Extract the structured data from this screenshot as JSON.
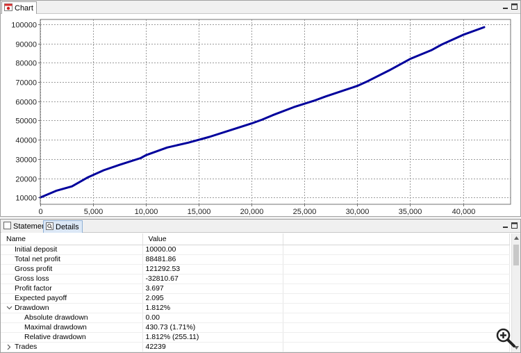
{
  "chart_tab": {
    "label": "Chart"
  },
  "details_tabs": {
    "statement": "Statement",
    "details": "Details"
  },
  "chart_data": {
    "type": "line",
    "x": [
      0,
      1500,
      3000,
      4500,
      6000,
      7500,
      9500,
      10000,
      12000,
      14000,
      16000,
      18000,
      20000,
      21000,
      22000,
      24000,
      26000,
      27000,
      30000,
      31000,
      33000,
      35000,
      37000,
      38000,
      40000,
      42000
    ],
    "y": [
      10000,
      13500,
      15800,
      20500,
      24200,
      27000,
      30500,
      32000,
      36000,
      38500,
      41500,
      45000,
      48500,
      50500,
      52800,
      57000,
      60500,
      62500,
      68000,
      70500,
      76000,
      82000,
      86500,
      89500,
      94500,
      98500
    ],
    "xlim": [
      0,
      44500
    ],
    "ylim": [
      6500,
      102500
    ],
    "xticks": [
      0,
      5000,
      10000,
      15000,
      20000,
      25000,
      30000,
      35000,
      40000
    ],
    "xtick_labels": [
      "0",
      "5,000",
      "10,000",
      "15,000",
      "20,000",
      "25,000",
      "30,000",
      "35,000",
      "40,000"
    ],
    "yticks": [
      10000,
      20000,
      30000,
      40000,
      50000,
      60000,
      70000,
      80000,
      90000,
      100000
    ],
    "ytick_labels": [
      "10000",
      "20000",
      "30000",
      "40000",
      "50000",
      "60000",
      "70000",
      "80000",
      "90000",
      "100000"
    ],
    "grid": true,
    "line_color": "#00009c"
  },
  "table": {
    "headers": {
      "name": "Name",
      "value": "Value"
    },
    "rows": [
      {
        "name": "Initial deposit",
        "value": "10000.00"
      },
      {
        "name": "Total net profit",
        "value": "88481.86"
      },
      {
        "name": "Gross profit",
        "value": "121292.53"
      },
      {
        "name": "Gross loss",
        "value": "-32810.67"
      },
      {
        "name": "Profit factor",
        "value": "3.697"
      },
      {
        "name": "Expected payoff",
        "value": "2.095"
      },
      {
        "name": "Drawdown",
        "value": "1.812%",
        "expander": "expanded"
      },
      {
        "name": "Absolute drawdown",
        "value": "0.00",
        "child": true
      },
      {
        "name": "Maximal drawdown",
        "value": "430.73 (1.71%)",
        "child": true
      },
      {
        "name": "Relative drawdown",
        "value": "1.812% (255.11)",
        "child": true
      },
      {
        "name": "Trades",
        "value": "42239",
        "expander": "collapsed"
      }
    ]
  },
  "icons": {
    "chart_tab": "chart-window-icon",
    "statement_tab": "statement-icon",
    "details_tab": "details-icon",
    "zoom": "magnifier-plus-icon"
  }
}
